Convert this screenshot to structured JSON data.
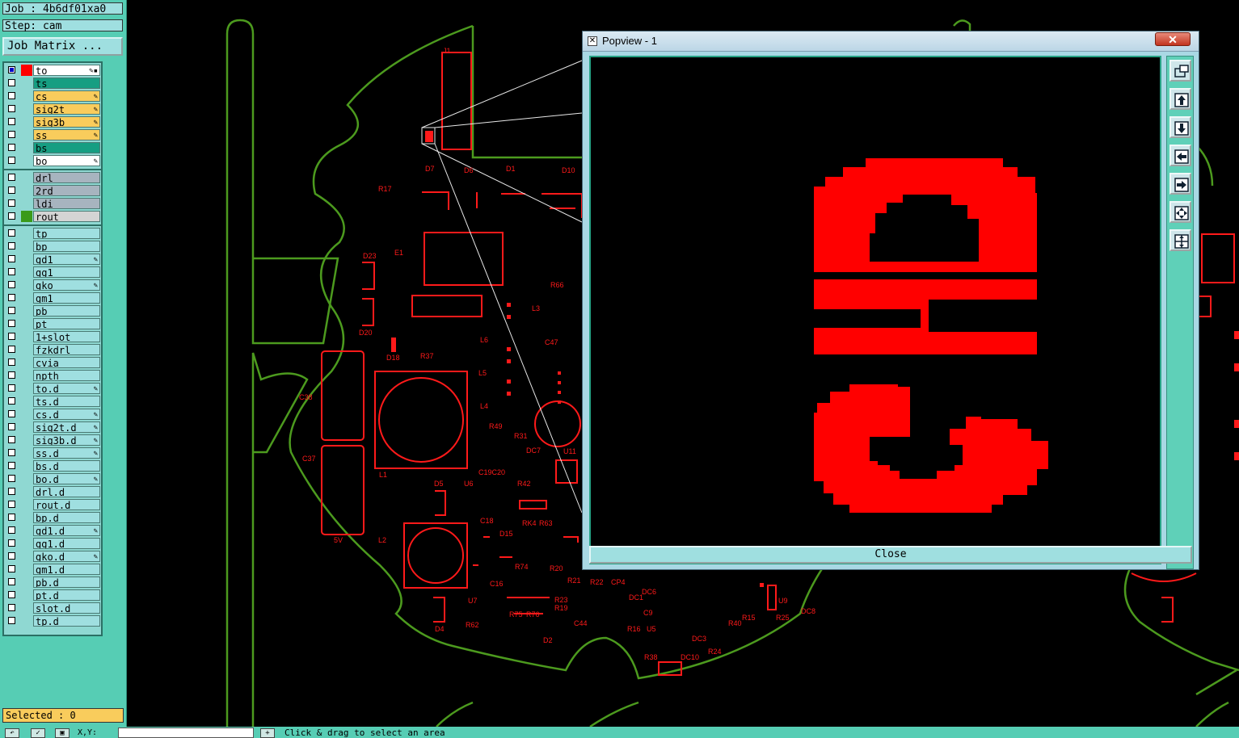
{
  "job": {
    "label": "Job : 4b6df01xa0",
    "step": "Step: cam",
    "matrix_button": "Job Matrix ..."
  },
  "colors": {
    "accent_panel": "#56cdb4",
    "outline": "#4c9a1e",
    "copper": "#ff1a1a",
    "sel_yellow": "#f9cc5c",
    "teal": "#169e82"
  },
  "layers": [
    {
      "name": "to",
      "bg": "#ffffff",
      "color": "#ff0000",
      "checked": true,
      "flag": "✎▪"
    },
    {
      "name": "ts",
      "bg": "#169e82",
      "color": "",
      "checked": false,
      "flag": ""
    },
    {
      "name": "cs",
      "bg": "#f9cc5c",
      "color": "",
      "checked": false,
      "flag": "✎"
    },
    {
      "name": "sig2t",
      "bg": "#f9cc5c",
      "color": "",
      "checked": false,
      "flag": "✎"
    },
    {
      "name": "sig3b",
      "bg": "#f9cc5c",
      "color": "",
      "checked": false,
      "flag": "✎"
    },
    {
      "name": "ss",
      "bg": "#f9cc5c",
      "color": "",
      "checked": false,
      "flag": "✎"
    },
    {
      "name": "bs",
      "bg": "#169e82",
      "color": "",
      "checked": false,
      "flag": ""
    },
    {
      "name": "bo",
      "bg": "#ffffff",
      "color": "",
      "checked": false,
      "flag": "✎"
    },
    {
      "name": "drl",
      "bg": "#a7b4bf",
      "color": "",
      "checked": false,
      "flag": ""
    },
    {
      "name": "2rd",
      "bg": "#a7b4bf",
      "color": "",
      "checked": false,
      "flag": ""
    },
    {
      "name": "ldi",
      "bg": "#a7b4bf",
      "color": "",
      "checked": false,
      "flag": ""
    },
    {
      "name": "rout",
      "bg": "#d4d4d4",
      "color": "#3a9a1a",
      "checked": false,
      "flag": ""
    },
    {
      "name": "tp",
      "bg": "#9fdfe0",
      "color": "",
      "checked": false,
      "flag": ""
    },
    {
      "name": "bp",
      "bg": "#9fdfe0",
      "color": "",
      "checked": false,
      "flag": ""
    },
    {
      "name": "gd1",
      "bg": "#9fdfe0",
      "color": "",
      "checked": false,
      "flag": "✎"
    },
    {
      "name": "gg1",
      "bg": "#9fdfe0",
      "color": "",
      "checked": false,
      "flag": ""
    },
    {
      "name": "gko",
      "bg": "#9fdfe0",
      "color": "",
      "checked": false,
      "flag": "✎"
    },
    {
      "name": "gm1",
      "bg": "#9fdfe0",
      "color": "",
      "checked": false,
      "flag": ""
    },
    {
      "name": "pb",
      "bg": "#9fdfe0",
      "color": "",
      "checked": false,
      "flag": ""
    },
    {
      "name": "pt",
      "bg": "#9fdfe0",
      "color": "",
      "checked": false,
      "flag": ""
    },
    {
      "name": "1+slot",
      "bg": "#9fdfe0",
      "color": "",
      "checked": false,
      "flag": ""
    },
    {
      "name": "fzkdrl",
      "bg": "#9fdfe0",
      "color": "",
      "checked": false,
      "flag": ""
    },
    {
      "name": "cvia",
      "bg": "#9fdfe0",
      "color": "",
      "checked": false,
      "flag": ""
    },
    {
      "name": "npth",
      "bg": "#9fdfe0",
      "color": "",
      "checked": false,
      "flag": ""
    },
    {
      "name": "to.d",
      "bg": "#9fdfe0",
      "color": "",
      "checked": false,
      "flag": "✎"
    },
    {
      "name": "ts.d",
      "bg": "#9fdfe0",
      "color": "",
      "checked": false,
      "flag": ""
    },
    {
      "name": "cs.d",
      "bg": "#9fdfe0",
      "color": "",
      "checked": false,
      "flag": "✎"
    },
    {
      "name": "sig2t.d",
      "bg": "#9fdfe0",
      "color": "",
      "checked": false,
      "flag": "✎"
    },
    {
      "name": "sig3b.d",
      "bg": "#9fdfe0",
      "color": "",
      "checked": false,
      "flag": "✎"
    },
    {
      "name": "ss.d",
      "bg": "#9fdfe0",
      "color": "",
      "checked": false,
      "flag": "✎"
    },
    {
      "name": "bs.d",
      "bg": "#9fdfe0",
      "color": "",
      "checked": false,
      "flag": ""
    },
    {
      "name": "bo.d",
      "bg": "#9fdfe0",
      "color": "",
      "checked": false,
      "flag": "✎"
    },
    {
      "name": "drl.d",
      "bg": "#9fdfe0",
      "color": "",
      "checked": false,
      "flag": ""
    },
    {
      "name": "rout.d",
      "bg": "#9fdfe0",
      "color": "",
      "checked": false,
      "flag": ""
    },
    {
      "name": "bp.d",
      "bg": "#9fdfe0",
      "color": "",
      "checked": false,
      "flag": ""
    },
    {
      "name": "gd1.d",
      "bg": "#9fdfe0",
      "color": "",
      "checked": false,
      "flag": "✎"
    },
    {
      "name": "gg1.d",
      "bg": "#9fdfe0",
      "color": "",
      "checked": false,
      "flag": ""
    },
    {
      "name": "gko.d",
      "bg": "#9fdfe0",
      "color": "",
      "checked": false,
      "flag": "✎"
    },
    {
      "name": "gm1.d",
      "bg": "#9fdfe0",
      "color": "",
      "checked": false,
      "flag": ""
    },
    {
      "name": "pb.d",
      "bg": "#9fdfe0",
      "color": "",
      "checked": false,
      "flag": ""
    },
    {
      "name": "pt.d",
      "bg": "#9fdfe0",
      "color": "",
      "checked": false,
      "flag": ""
    },
    {
      "name": "slot.d",
      "bg": "#9fdfe0",
      "color": "",
      "checked": false,
      "flag": ""
    },
    {
      "name": "tp.d",
      "bg": "#9fdfe0",
      "color": "",
      "checked": false,
      "flag": ""
    }
  ],
  "selected": "Selected : 0",
  "popview": {
    "title": "Popview - 1",
    "close_x": "✕",
    "close_button": "Close",
    "zoomed_text": "GND",
    "tools": [
      "zoom-window-icon",
      "pan-up-icon",
      "pan-down-icon",
      "pan-left-icon",
      "pan-right-icon",
      "zoom-fit-icon",
      "zoom-home-icon"
    ]
  },
  "canvas": {
    "labels": [
      "J1",
      "D7",
      "D6",
      "D1",
      "D10",
      "R17",
      "D23",
      "E1",
      "D20",
      "R66",
      "L3",
      "C47",
      "L6",
      "L5",
      "L4",
      "D18",
      "R37",
      "C38",
      "C37",
      "L1",
      "R49",
      "R31",
      "DC7",
      "U11",
      "C19C20",
      "D5",
      "U6",
      "R42",
      "L2",
      "C18",
      "D15",
      "RK4",
      "R63",
      "5V",
      "R74",
      "R20",
      "R21",
      "C16",
      "R22",
      "CP4",
      "DC6",
      "DC1",
      "U7",
      "R23",
      "R19",
      "R75",
      "R76",
      "C9",
      "D4",
      "R62",
      "C44",
      "R16",
      "U5",
      "D2",
      "DC3",
      "R38",
      "DC10",
      "R24",
      "R40",
      "R15",
      "U9",
      "R25",
      "DC8"
    ]
  },
  "bottom": {
    "coord_label": "X,Y:",
    "status": "Click & drag to select an area"
  }
}
